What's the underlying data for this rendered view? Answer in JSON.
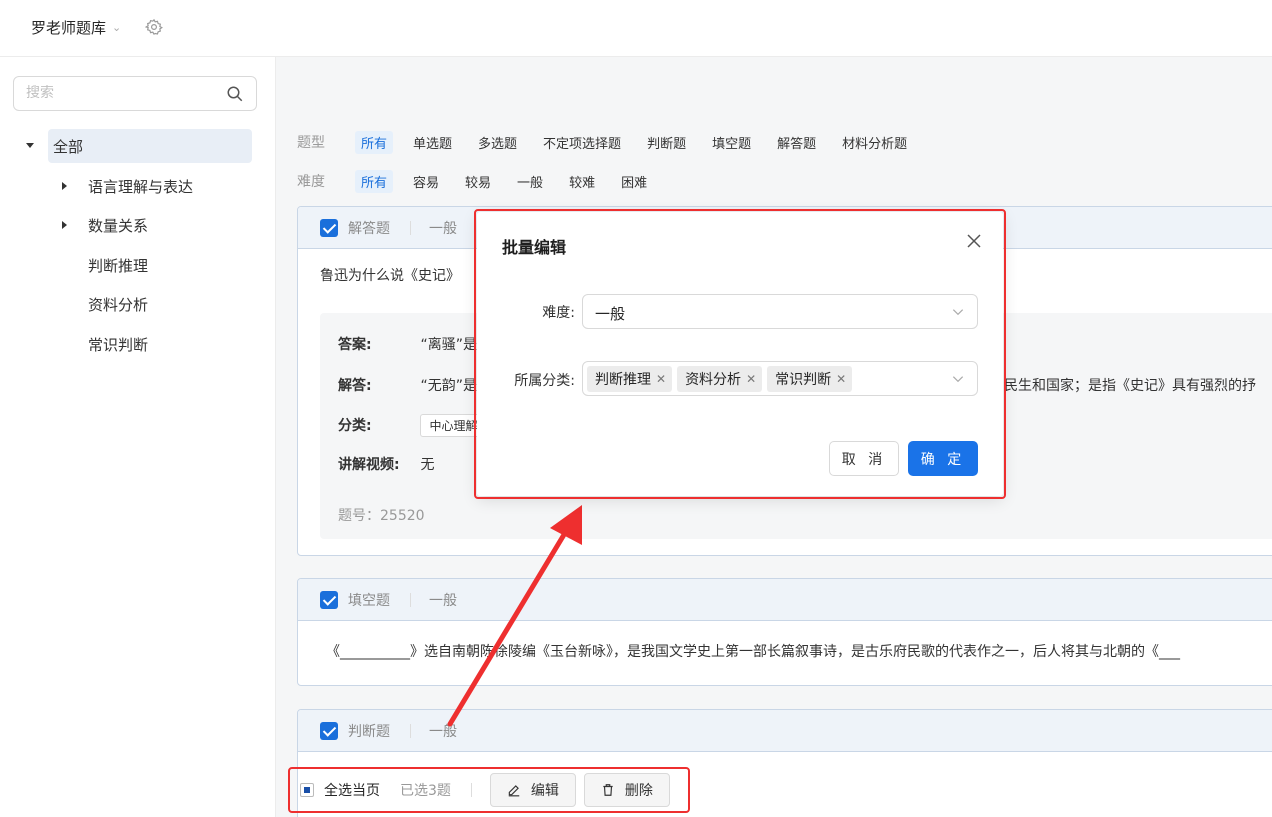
{
  "header": {
    "title": "罗老师题库"
  },
  "sidebar": {
    "search_placeholder": "搜索",
    "root": "全部",
    "items": [
      {
        "label": "语言理解与表达",
        "expandable": true
      },
      {
        "label": "数量关系",
        "expandable": true
      },
      {
        "label": "判断推理",
        "expandable": false
      },
      {
        "label": "资料分析",
        "expandable": false
      },
      {
        "label": "常识判断",
        "expandable": false
      }
    ]
  },
  "filters": {
    "type_label": "题型",
    "types": [
      "所有",
      "单选题",
      "多选题",
      "不定项选择题",
      "判断题",
      "填空题",
      "解答题",
      "材料分析题"
    ],
    "difficulty_label": "难度",
    "difficulties": [
      "所有",
      "容易",
      "较易",
      "一般",
      "较难",
      "困难"
    ]
  },
  "cards": [
    {
      "type": "解答题",
      "difficulty": "一般",
      "question": "鲁迅为什么说《史记》",
      "answer_label": "答案:",
      "answer": "“离骚”是",
      "explain_label": "解答:",
      "explain": "“无韵”是",
      "explain_tail": "民生和国家；是指《史记》具有强烈的抒",
      "category_label": "分类:",
      "category": "中心理解",
      "video_label": "讲解视频:",
      "video": "无",
      "id_text": "题号：25520"
    },
    {
      "type": "填空题",
      "difficulty": "一般",
      "question": "《__________》选自南朝陈徐陵编《玉台新咏》，是我国文学史上第一部长篇叙事诗，是古乐府民歌的代表作之一，后人将其与北朝的《___"
    },
    {
      "type": "判断题",
      "difficulty": "一般"
    }
  ],
  "bottom_bar": {
    "select_all": "全选当页",
    "selected": "已选3题",
    "edit": "编辑",
    "delete": "删除"
  },
  "modal": {
    "title": "批量编辑",
    "difficulty_label": "难度:",
    "difficulty_value": "一般",
    "category_label": "所属分类:",
    "categories": [
      "判断推理",
      "资料分析",
      "常识判断"
    ],
    "cancel": "取 消",
    "ok": "确 定"
  },
  "colors": {
    "primary": "#1a73e8",
    "highlight": "#ee2f2f"
  }
}
